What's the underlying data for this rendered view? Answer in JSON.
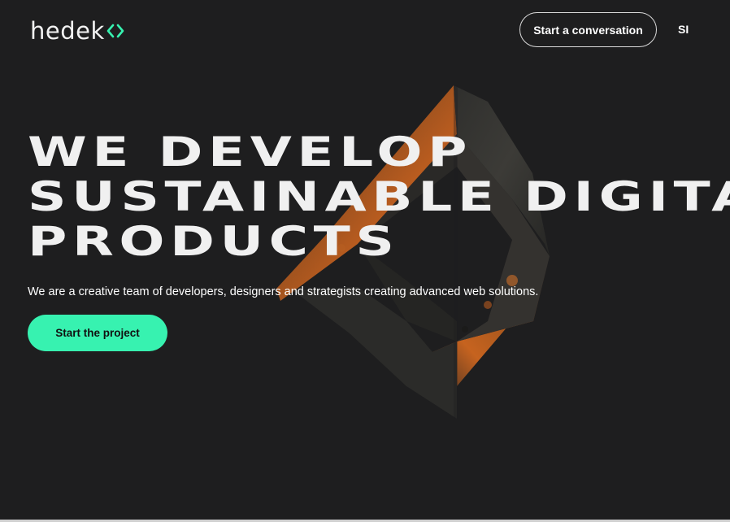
{
  "header": {
    "logo_text": "hedek",
    "logo_mark_icon": "code-brackets-icon",
    "nav_button_label": "Start a conversation",
    "language": "SI"
  },
  "hero": {
    "headline_lines": [
      "WE DEVELOP",
      "SUSTAINABLE DIGITAL",
      "PRODUCTS"
    ],
    "subtitle": "We are a creative team of developers, designers and strategists creating advanced web solutions.",
    "cta_label": "Start the project",
    "decoration": "rusted-3d-diamond-frame"
  },
  "colors": {
    "background": "#1e1e1f",
    "accent": "#37f2b0",
    "text": "#f0f0f0"
  }
}
